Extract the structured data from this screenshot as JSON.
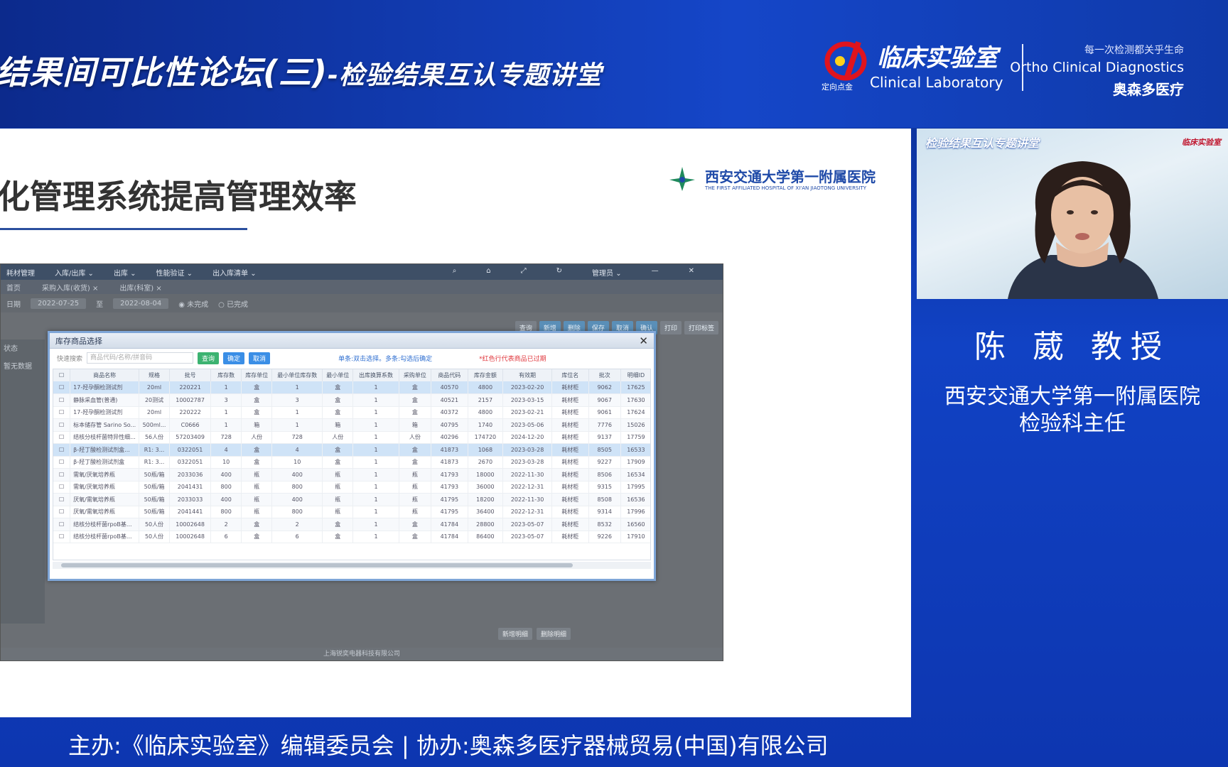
{
  "banner": {
    "title_main": "结果间可比性论坛",
    "title_num": "(三)",
    "title_sub": "-检验结果互认专题讲堂"
  },
  "logo": {
    "cn": "临床实验室",
    "en": "Clinical Laboratory",
    "tiny": "定向点金"
  },
  "sponsor": {
    "slogan": "每一次检测都关乎生命",
    "en": "Ortho Clinical Diagnostics",
    "cn": "奥森多医疗"
  },
  "slide": {
    "title": "化管理系统提高管理效率",
    "hospital_cn": "西安交通大学第一附属医院",
    "hospital_en": "THE FIRST AFFILIATED HOSPITAL OF XI'AN JIAOTONG UNIVERSITY"
  },
  "app": {
    "menu": [
      "耗材管理",
      "入库/出库 ⌄",
      "出库 ⌄",
      "性能验证 ⌄",
      "出入库清单 ⌄"
    ],
    "menu_right": "管理员 ⌄",
    "tabs": [
      "首页",
      "采购入库(收货) ×",
      "出库(科室) ×"
    ],
    "filter": {
      "label": "日期",
      "from": "2022-07-25",
      "to_label": "至",
      "to": "2022-08-04",
      "opt1": "未完成",
      "opt2": "已完成"
    },
    "toolbar": [
      "查询",
      "新增",
      "删除",
      "保存",
      "取消",
      "确认",
      "打印",
      "打印标签"
    ],
    "left": [
      "状态",
      "暂无数据"
    ],
    "bottom_btns": [
      "新增明细",
      "删除明细"
    ],
    "footer": "上海锐奕电器科技有限公司"
  },
  "modal": {
    "title": "库存商品选择",
    "search_label": "快速搜索",
    "search_placeholder": "商品代码/名称/拼音码",
    "btn_query": "查询",
    "btn_confirm": "确定",
    "btn_cancel": "取消",
    "hint": "单条:双击选择。多条:勾选后确定",
    "hint_red": "*红色行代表商品已过期",
    "columns": [
      "",
      "商品名称",
      "规格",
      "批号",
      "库存数",
      "库存单位",
      "最小单位库存数",
      "最小单位",
      "出库换算系数",
      "采购单位",
      "商品代码",
      "库存金额",
      "有效期",
      "库位名",
      "批次",
      "明细ID"
    ],
    "rows": [
      [
        "",
        "17-羟孕酮检测试剂",
        "20ml",
        "220221",
        "1",
        "盒",
        "1",
        "盒",
        "1",
        "盒",
        "40570",
        "4800",
        "2023-02-20",
        "耗材柜",
        "9062",
        "17625"
      ],
      [
        "",
        "静脉采血管(普通)",
        "20测试",
        "10002787",
        "3",
        "盒",
        "3",
        "盒",
        "1",
        "盒",
        "40521",
        "2157",
        "2023-03-15",
        "耗材柜",
        "9067",
        "17630"
      ],
      [
        "",
        "17-羟孕酮检测试剂",
        "20ml",
        "220222",
        "1",
        "盒",
        "1",
        "盒",
        "1",
        "盒",
        "40372",
        "4800",
        "2023-02-21",
        "耗材柜",
        "9061",
        "17624"
      ],
      [
        "",
        "标本储存管 Sarino So...",
        "500ml...",
        "C0666",
        "1",
        "箱",
        "1",
        "箱",
        "1",
        "箱",
        "40795",
        "1740",
        "2023-05-06",
        "耗材柜",
        "7776",
        "15026"
      ],
      [
        "",
        "结核分枝杆菌特异性细...",
        "56人份",
        "57203409",
        "728",
        "人份",
        "728",
        "人份",
        "1",
        "人份",
        "40296",
        "174720",
        "2024-12-20",
        "耗材柜",
        "9137",
        "17759"
      ],
      [
        "",
        "β-羟丁酸检测试剂盒...",
        "R1: 3...",
        "0322051",
        "4",
        "盒",
        "4",
        "盒",
        "1",
        "盒",
        "41873",
        "1068",
        "2023-03-28",
        "耗材柜",
        "8505",
        "16533"
      ],
      [
        "",
        "β-羟丁酸检测试剂盒",
        "R1: 3...",
        "0322051",
        "10",
        "盒",
        "10",
        "盒",
        "1",
        "盒",
        "41873",
        "2670",
        "2023-03-28",
        "耗材柜",
        "9227",
        "17909"
      ],
      [
        "",
        "需氧/厌氧培养瓶",
        "50瓶/箱",
        "2033036",
        "400",
        "瓶",
        "400",
        "瓶",
        "1",
        "瓶",
        "41793",
        "18000",
        "2022-11-30",
        "耗材柜",
        "8506",
        "16534"
      ],
      [
        "",
        "需氧/厌氧培养瓶",
        "50瓶/箱",
        "2041431",
        "800",
        "瓶",
        "800",
        "瓶",
        "1",
        "瓶",
        "41793",
        "36000",
        "2022-12-31",
        "耗材柜",
        "9315",
        "17995"
      ],
      [
        "",
        "厌氧/需氧培养瓶",
        "50瓶/箱",
        "2033033",
        "400",
        "瓶",
        "400",
        "瓶",
        "1",
        "瓶",
        "41795",
        "18200",
        "2022-11-30",
        "耗材柜",
        "8508",
        "16536"
      ],
      [
        "",
        "厌氧/需氧培养瓶",
        "50瓶/箱",
        "2041441",
        "800",
        "瓶",
        "800",
        "瓶",
        "1",
        "瓶",
        "41795",
        "36400",
        "2022-12-31",
        "耗材柜",
        "9314",
        "17996"
      ],
      [
        "",
        "结核分枝杆菌rpoB基...",
        "50人份",
        "10002648",
        "2",
        "盒",
        "2",
        "盒",
        "1",
        "盒",
        "41784",
        "28800",
        "2023-05-07",
        "耗材柜",
        "8532",
        "16560"
      ],
      [
        "",
        "结核分枝杆菌rpoB基...",
        "50人份",
        "10002648",
        "6",
        "盒",
        "6",
        "盒",
        "1",
        "盒",
        "41784",
        "86400",
        "2023-05-07",
        "耗材柜",
        "9226",
        "17910"
      ]
    ]
  },
  "camera": {
    "banner": "检验结果互认专题讲堂",
    "mini": "临床实验室"
  },
  "speaker": {
    "name": "陈 葳 教授",
    "affil1": "西安交通大学第一附属医院",
    "affil2": "检验科主任"
  },
  "footer_bar": "主办:《临床实验室》编辑委员会 | 协办:奥森多医疗器械贸易(中国)有限公司",
  "colors": {
    "brand_blue": "#1142c4",
    "modal_border": "#7fa6d8",
    "selected_row": "#cfe3f7",
    "hint_red": "#e0383e"
  }
}
